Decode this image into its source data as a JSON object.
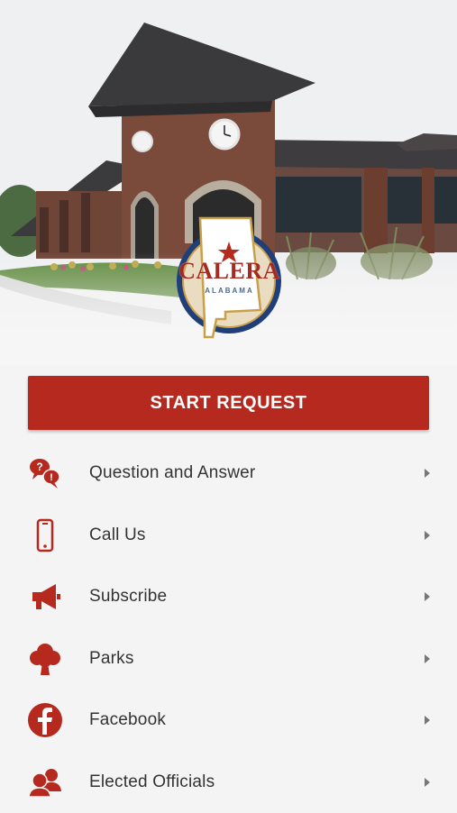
{
  "hero": {
    "logo_name": "CALERA",
    "logo_state": "ALABAMA"
  },
  "cta": {
    "label": "START REQUEST"
  },
  "menu": [
    {
      "label": "Question and Answer",
      "icon": "question-answer-icon"
    },
    {
      "label": "Call Us",
      "icon": "phone-icon"
    },
    {
      "label": "Subscribe",
      "icon": "megaphone-icon"
    },
    {
      "label": "Parks",
      "icon": "tree-icon"
    },
    {
      "label": "Facebook",
      "icon": "facebook-icon"
    },
    {
      "label": "Elected Officials",
      "icon": "officials-icon"
    }
  ],
  "colors": {
    "accent": "#b5291e",
    "logo_blue": "#1f3f7a",
    "logo_gold": "#c9a04a"
  }
}
